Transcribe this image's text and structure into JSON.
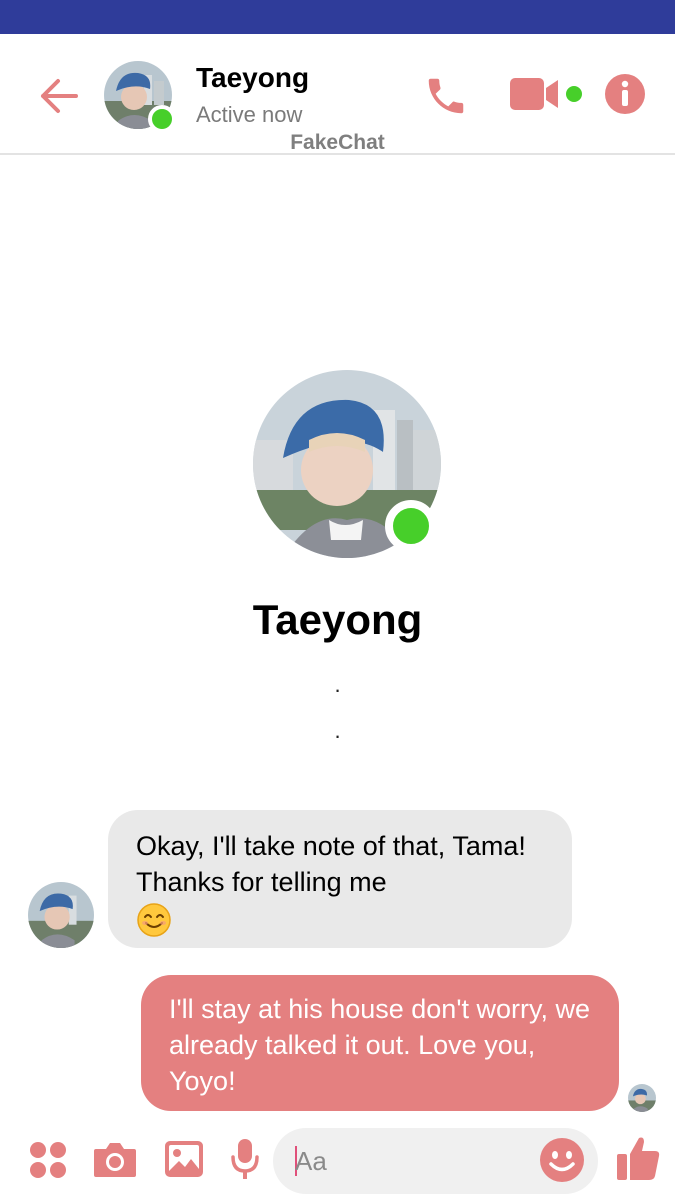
{
  "header": {
    "contact_name": "Taeyong",
    "status": "Active now",
    "watermark": "FakeChat"
  },
  "profile": {
    "name": "Taeyong",
    "dot1": ".",
    "dot2": "."
  },
  "messages": [
    {
      "direction": "incoming",
      "text": "Okay,  I'll take note of that, Tama! Thanks for telling me",
      "emoji": "smiling-face-icon"
    },
    {
      "direction": "outgoing",
      "text": "I'll stay at his house don't worry, we already talked it out. Love you, Yoyo!"
    }
  ],
  "composer": {
    "placeholder": "Aa"
  },
  "icons": {
    "back": "arrow-left-icon",
    "call": "phone-icon",
    "video": "video-camera-icon",
    "info": "info-icon",
    "apps": "grid-dots-icon",
    "camera": "camera-icon",
    "image": "image-icon",
    "mic": "microphone-icon",
    "emoji": "smiley-icon",
    "like": "thumbs-up-icon"
  },
  "colors": {
    "accent": "#e48080",
    "status_bar": "#2f3c9a",
    "online": "#47cf2a",
    "incoming_bubble": "#e9e9e9"
  }
}
